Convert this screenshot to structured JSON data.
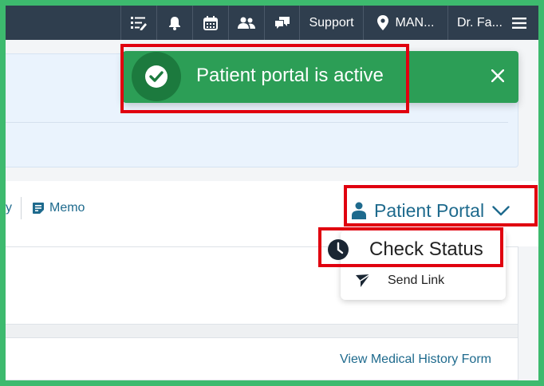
{
  "topbar": {
    "support_label": "Support",
    "location_label": "MAN...",
    "user_label": "Dr. Fa..."
  },
  "toast": {
    "message": "Patient portal is active",
    "color": "#2c9e56"
  },
  "tabs": {
    "partial_label": "y",
    "memo_label": "Memo"
  },
  "patient_portal": {
    "label": "Patient Portal",
    "menu": {
      "check_status": "Check Status",
      "send_link": "Send Link"
    }
  },
  "content": {
    "view_history_link": "View Medical History Form"
  },
  "colors": {
    "border_green": "#3dba6e",
    "nav_bg": "#2f3e4e",
    "link": "#1e6a8d",
    "highlight": "#e0000f"
  },
  "icons": [
    "checklist-icon",
    "bell-icon",
    "calendar-icon",
    "users-icon",
    "chat-icon",
    "location-pin-icon",
    "hamburger-menu-icon",
    "check-circle-icon",
    "close-icon",
    "memo-icon",
    "person-icon",
    "chevron-down-icon",
    "clock-icon",
    "send-icon"
  ]
}
